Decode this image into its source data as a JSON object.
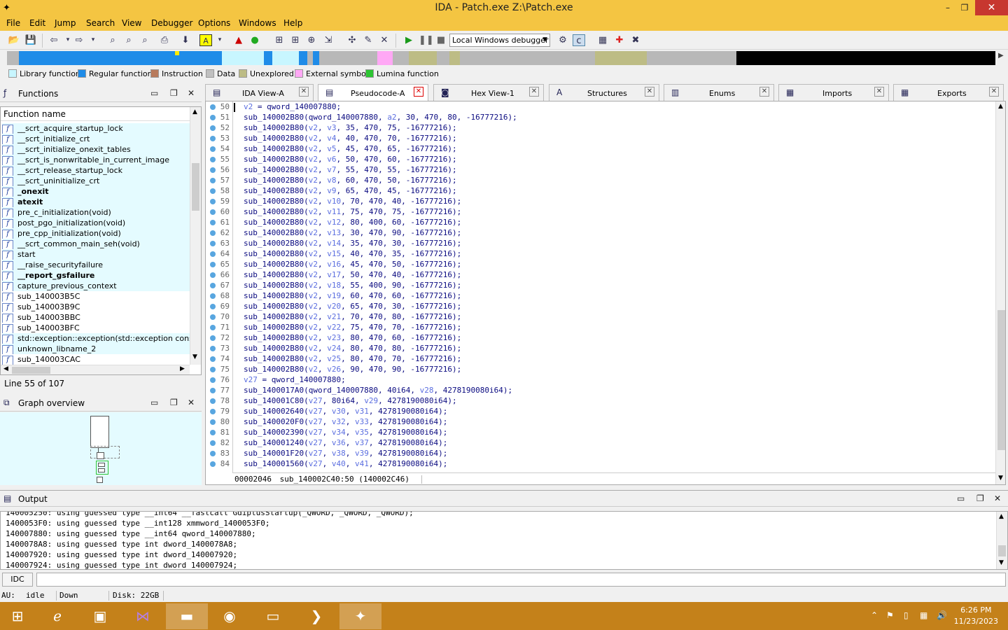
{
  "window": {
    "title": "IDA - Patch.exe Z:\\Patch.exe",
    "min": "–",
    "max": "❐",
    "close": "✕"
  },
  "menu": [
    "File",
    "Edit",
    "Jump",
    "Search",
    "View",
    "Debugger",
    "Options",
    "Windows",
    "Help"
  ],
  "toolbar": {
    "debugger_select": "Local Windows debugger"
  },
  "legend": [
    {
      "label": "Library function",
      "color": "#c8f6ff"
    },
    {
      "label": "Regular function",
      "color": "#1f8ce8"
    },
    {
      "label": "Instruction",
      "color": "#b87a5c"
    },
    {
      "label": "Data",
      "color": "#c0c0c0"
    },
    {
      "label": "Unexplored",
      "color": "#bdbc85"
    },
    {
      "label": "External symbol",
      "color": "#ffa8f5"
    },
    {
      "label": "Lumina function",
      "color": "#2dc533"
    }
  ],
  "functions": {
    "title": "Functions",
    "column": "Function name",
    "items": [
      {
        "name": "__scrt_acquire_startup_lock",
        "bold": false,
        "lib": true
      },
      {
        "name": "__scrt_initialize_crt",
        "bold": false,
        "lib": true
      },
      {
        "name": "__scrt_initialize_onexit_tables",
        "bold": false,
        "lib": true
      },
      {
        "name": "__scrt_is_nonwritable_in_current_image",
        "bold": false,
        "lib": true
      },
      {
        "name": "__scrt_release_startup_lock",
        "bold": false,
        "lib": true
      },
      {
        "name": "__scrt_uninitialize_crt",
        "bold": false,
        "lib": true
      },
      {
        "name": "_onexit",
        "bold": true,
        "lib": true
      },
      {
        "name": "atexit",
        "bold": true,
        "lib": true
      },
      {
        "name": "pre_c_initialization(void)",
        "bold": false,
        "lib": true
      },
      {
        "name": "post_pgo_initialization(void)",
        "bold": false,
        "lib": true
      },
      {
        "name": "pre_cpp_initialization(void)",
        "bold": false,
        "lib": true
      },
      {
        "name": "__scrt_common_main_seh(void)",
        "bold": false,
        "lib": true
      },
      {
        "name": "start",
        "bold": false,
        "lib": true
      },
      {
        "name": "__raise_securityfailure",
        "bold": false,
        "lib": true
      },
      {
        "name": "__report_gsfailure",
        "bold": true,
        "lib": true
      },
      {
        "name": "capture_previous_context",
        "bold": false,
        "lib": true
      },
      {
        "name": "sub_140003B5C",
        "bold": false,
        "lib": false
      },
      {
        "name": "sub_140003B9C",
        "bold": false,
        "lib": false
      },
      {
        "name": "sub_140003BBC",
        "bold": false,
        "lib": false
      },
      {
        "name": "sub_140003BFC",
        "bold": false,
        "lib": false
      },
      {
        "name": "std::exception::exception(std::exception const &)",
        "bold": false,
        "lib": true
      },
      {
        "name": "unknown_libname_2",
        "bold": false,
        "lib": true
      },
      {
        "name": "sub_140003CAC",
        "bold": false,
        "lib": false
      }
    ],
    "status": "Line 55 of 107"
  },
  "graph_overview": {
    "title": "Graph overview"
  },
  "tabs": [
    {
      "label": "IDA View-A",
      "icon": "▤"
    },
    {
      "label": "Pseudocode-A",
      "icon": "▤"
    },
    {
      "label": "Hex View-1",
      "icon": "◙"
    },
    {
      "label": "Structures",
      "icon": "A"
    },
    {
      "label": "Enums",
      "icon": "▥"
    },
    {
      "label": "Imports",
      "icon": "▦"
    },
    {
      "label": "Exports",
      "icon": "▦"
    }
  ],
  "code": {
    "lines": [
      {
        "n": "50",
        "t": "v2 = qword_140007880;"
      },
      {
        "n": "51",
        "t": "sub_140002B80(qword_140007880, a2, 30, 470, 80, -16777216);"
      },
      {
        "n": "52",
        "t": "sub_140002B80(v2, v3, 35, 470, 75, -16777216);"
      },
      {
        "n": "53",
        "t": "sub_140002B80(v2, v4, 40, 470, 70, -16777216);"
      },
      {
        "n": "54",
        "t": "sub_140002B80(v2, v5, 45, 470, 65, -16777216);"
      },
      {
        "n": "55",
        "t": "sub_140002B80(v2, v6, 50, 470, 60, -16777216);"
      },
      {
        "n": "56",
        "t": "sub_140002B80(v2, v7, 55, 470, 55, -16777216);"
      },
      {
        "n": "57",
        "t": "sub_140002B80(v2, v8, 60, 470, 50, -16777216);"
      },
      {
        "n": "58",
        "t": "sub_140002B80(v2, v9, 65, 470, 45, -16777216);"
      },
      {
        "n": "59",
        "t": "sub_140002B80(v2, v10, 70, 470, 40, -16777216);"
      },
      {
        "n": "60",
        "t": "sub_140002B80(v2, v11, 75, 470, 75, -16777216);"
      },
      {
        "n": "61",
        "t": "sub_140002B80(v2, v12, 80, 400, 60, -16777216);"
      },
      {
        "n": "62",
        "t": "sub_140002B80(v2, v13, 30, 470, 90, -16777216);"
      },
      {
        "n": "63",
        "t": "sub_140002B80(v2, v14, 35, 470, 30, -16777216);"
      },
      {
        "n": "64",
        "t": "sub_140002B80(v2, v15, 40, 470, 35, -16777216);"
      },
      {
        "n": "65",
        "t": "sub_140002B80(v2, v16, 45, 470, 50, -16777216);"
      },
      {
        "n": "66",
        "t": "sub_140002B80(v2, v17, 50, 470, 40, -16777216);"
      },
      {
        "n": "67",
        "t": "sub_140002B80(v2, v18, 55, 400, 90, -16777216);"
      },
      {
        "n": "68",
        "t": "sub_140002B80(v2, v19, 60, 470, 60, -16777216);"
      },
      {
        "n": "69",
        "t": "sub_140002B80(v2, v20, 65, 470, 30, -16777216);"
      },
      {
        "n": "70",
        "t": "sub_140002B80(v2, v21, 70, 470, 80, -16777216);"
      },
      {
        "n": "71",
        "t": "sub_140002B80(v2, v22, 75, 470, 70, -16777216);"
      },
      {
        "n": "72",
        "t": "sub_140002B80(v2, v23, 80, 470, 60, -16777216);"
      },
      {
        "n": "73",
        "t": "sub_140002B80(v2, v24, 80, 470, 80, -16777216);"
      },
      {
        "n": "74",
        "t": "sub_140002B80(v2, v25, 80, 470, 70, -16777216);"
      },
      {
        "n": "75",
        "t": "sub_140002B80(v2, v26, 90, 470, 90, -16777216);"
      },
      {
        "n": "76",
        "t": "v27 = qword_140007880;"
      },
      {
        "n": "77",
        "t": "sub_1400017A0(qword_140007880, 40i64, v28, 4278190080i64);"
      },
      {
        "n": "78",
        "t": "sub_140001C80(v27, 80i64, v29, 4278190080i64);"
      },
      {
        "n": "79",
        "t": "sub_140002640(v27, v30, v31, 4278190080i64);"
      },
      {
        "n": "80",
        "t": "sub_1400020F0(v27, v32, v33, 4278190080i64);"
      },
      {
        "n": "81",
        "t": "sub_140002390(v27, v34, v35, 4278190080i64);"
      },
      {
        "n": "82",
        "t": "sub_140001240(v27, v36, v37, 4278190080i64);"
      },
      {
        "n": "83",
        "t": "sub_140001F20(v27, v38, v39, 4278190080i64);"
      },
      {
        "n": "84",
        "t": "sub_140001560(v27, v40, v41, 4278190080i64);"
      }
    ],
    "status_addr": "00002046",
    "status_loc": "sub_140002C40:50 (140002C46)"
  },
  "output": {
    "title": "Output",
    "lines": [
      "140005250: using guessed type __int64 __fastcall GdiplusStartup(_QWORD, _QWORD, _QWORD);",
      "1400053F0: using guessed type __int128 xmmword_1400053F0;",
      "140007880: using guessed type __int64 qword_140007880;",
      "1400078A8: using guessed type int dword_1400078A8;",
      "140007920: using guessed type int dword_140007920;",
      "140007924: using guessed type int dword_140007924;"
    ],
    "idc_label": "IDC"
  },
  "status": {
    "au": "AU:",
    "state": "idle",
    "dir": "Down",
    "disk": "Disk: 22GB"
  },
  "clock": {
    "time": "6:26 PM",
    "date": "11/23/2023"
  }
}
